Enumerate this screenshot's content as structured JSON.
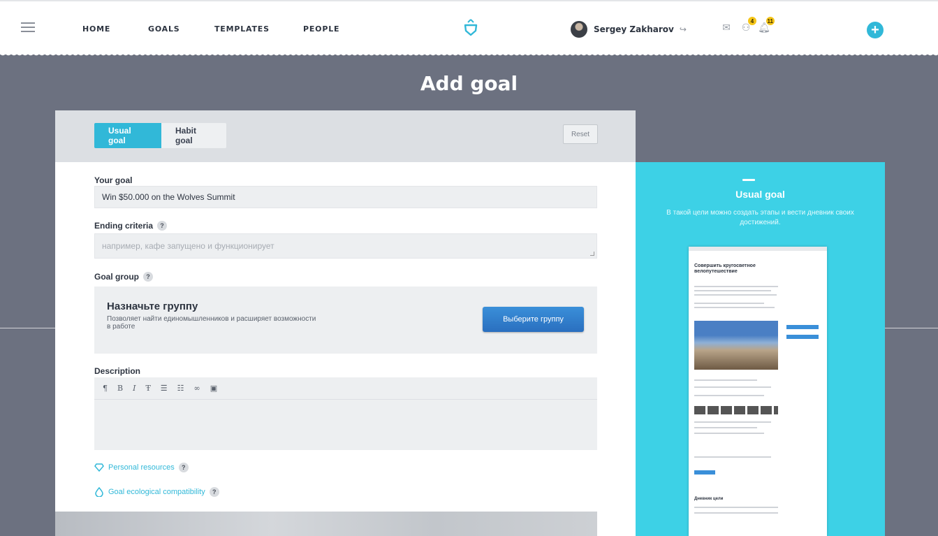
{
  "nav": {
    "items": [
      "HOME",
      "GOALS",
      "TEMPLATES",
      "PEOPLE"
    ],
    "user_name": "Sergey Zakharov",
    "badges": {
      "people": "4",
      "notifications": "11"
    }
  },
  "page": {
    "title": "Add goal"
  },
  "form": {
    "tabs": [
      "Usual goal",
      "Habit goal"
    ],
    "active_tab": "Usual goal",
    "reset_label": "Reset",
    "goal_label": "Your goal",
    "goal_value": "Win $50.000 on the Wolves Summit",
    "ending_label": "Ending criteria",
    "ending_placeholder": "например, кафе запущено и функционирует",
    "group_label": "Goal group",
    "group_title": "Назначьте группу",
    "group_desc": "Позволяет найти единомышленников и расширяет возможности в работе",
    "group_button": "Выберите группу",
    "description_label": "Description",
    "toolbar": [
      "¶",
      "B",
      "I",
      "Ŧ",
      "☰",
      "☷",
      "∞",
      "▣"
    ],
    "personal_resources": "Personal resources",
    "eco_compat": "Goal ecological compatibility",
    "help": "?"
  },
  "info": {
    "title": "Usual goal",
    "text": "В такой цели можно создать этапы и вести дневник своих достижений.",
    "preview_heading": "Совершить кругосветное велопутешествие",
    "preview_section": "Дневник цели"
  },
  "colors": {
    "accent": "#31b8d8",
    "panel": "#3dd1e6",
    "background": "#6c7180",
    "button": "#2a6fbf"
  }
}
